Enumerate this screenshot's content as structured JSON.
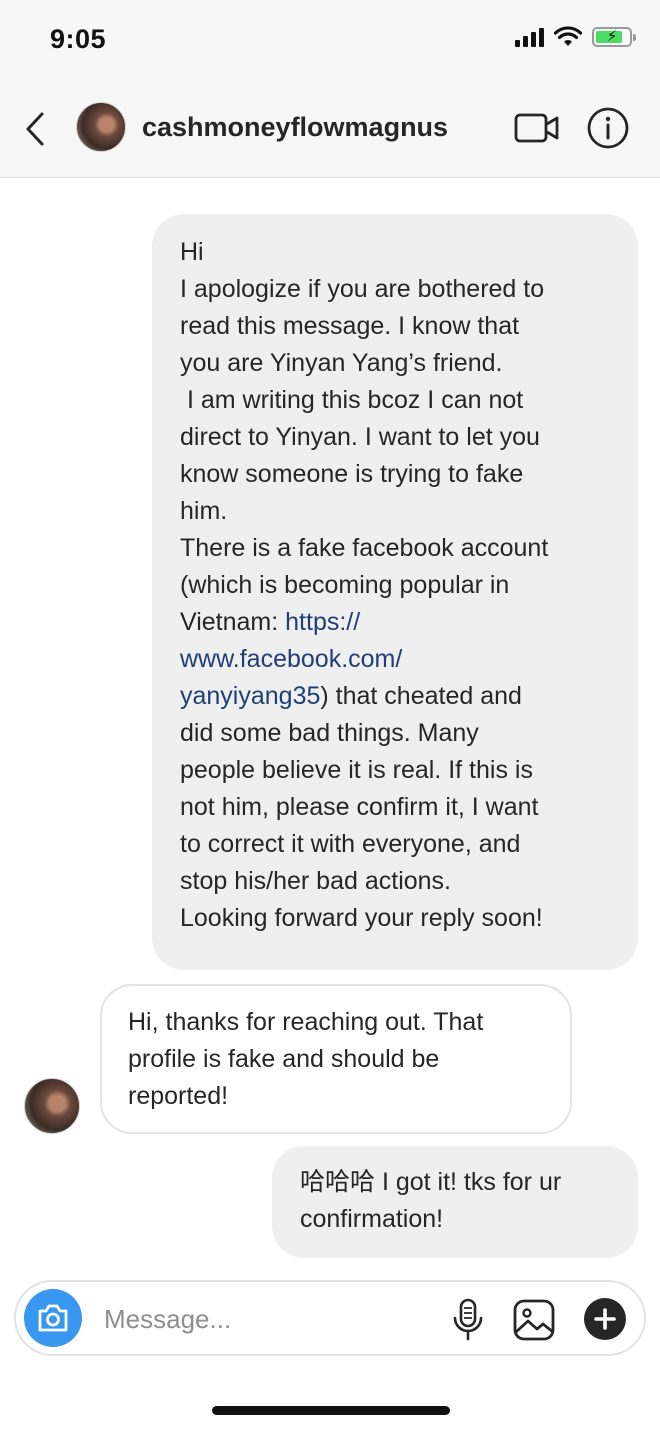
{
  "status_bar": {
    "time": "9:05",
    "icons": [
      "signal-icon",
      "wifi-icon",
      "battery-charging-icon"
    ],
    "battery_level": 0.8,
    "battery_color": "#4cd964"
  },
  "header": {
    "back_icon": "chevron-left-icon",
    "username": "cashmoneyflowmagnus",
    "video_icon": "video-call-icon",
    "info_icon": "info-icon"
  },
  "messages": [
    {
      "direction": "sent",
      "lines": [
        "Hi",
        "I apologize if you are bothered to",
        "read this message. I know that",
        "you are Yinyan Yang’s friend.",
        " I am writing this bcoz I can not",
        "direct to Yinyan. I want to let you",
        "know someone is trying to fake",
        "him.",
        "There is a fake facebook account",
        "(which is becoming popular in",
        "Vietnam: ",
        "https://",
        "www.facebook.com/",
        "yanyiyang35",
        ") that cheated and",
        "did some bad things. Many",
        "people believe it is real. If this is",
        "not him, please confirm it, I want",
        "to correct it with everyone, and",
        "stop his/her bad actions.",
        "Looking forward your reply soon!"
      ]
    },
    {
      "direction": "received",
      "lines": [
        "Hi, thanks for reaching out. That",
        "profile is fake and should be",
        "reported!"
      ]
    },
    {
      "direction": "sent",
      "lines": [
        "哈哈哈 I got it! tks for ur",
        "confirmation!"
      ]
    }
  ],
  "composer": {
    "placeholder": "Message...",
    "camera_icon": "camera-icon",
    "mic_icon": "microphone-icon",
    "gallery_icon": "gallery-icon",
    "plus_icon": "plus-icon",
    "accent_color": "#3897f0"
  }
}
